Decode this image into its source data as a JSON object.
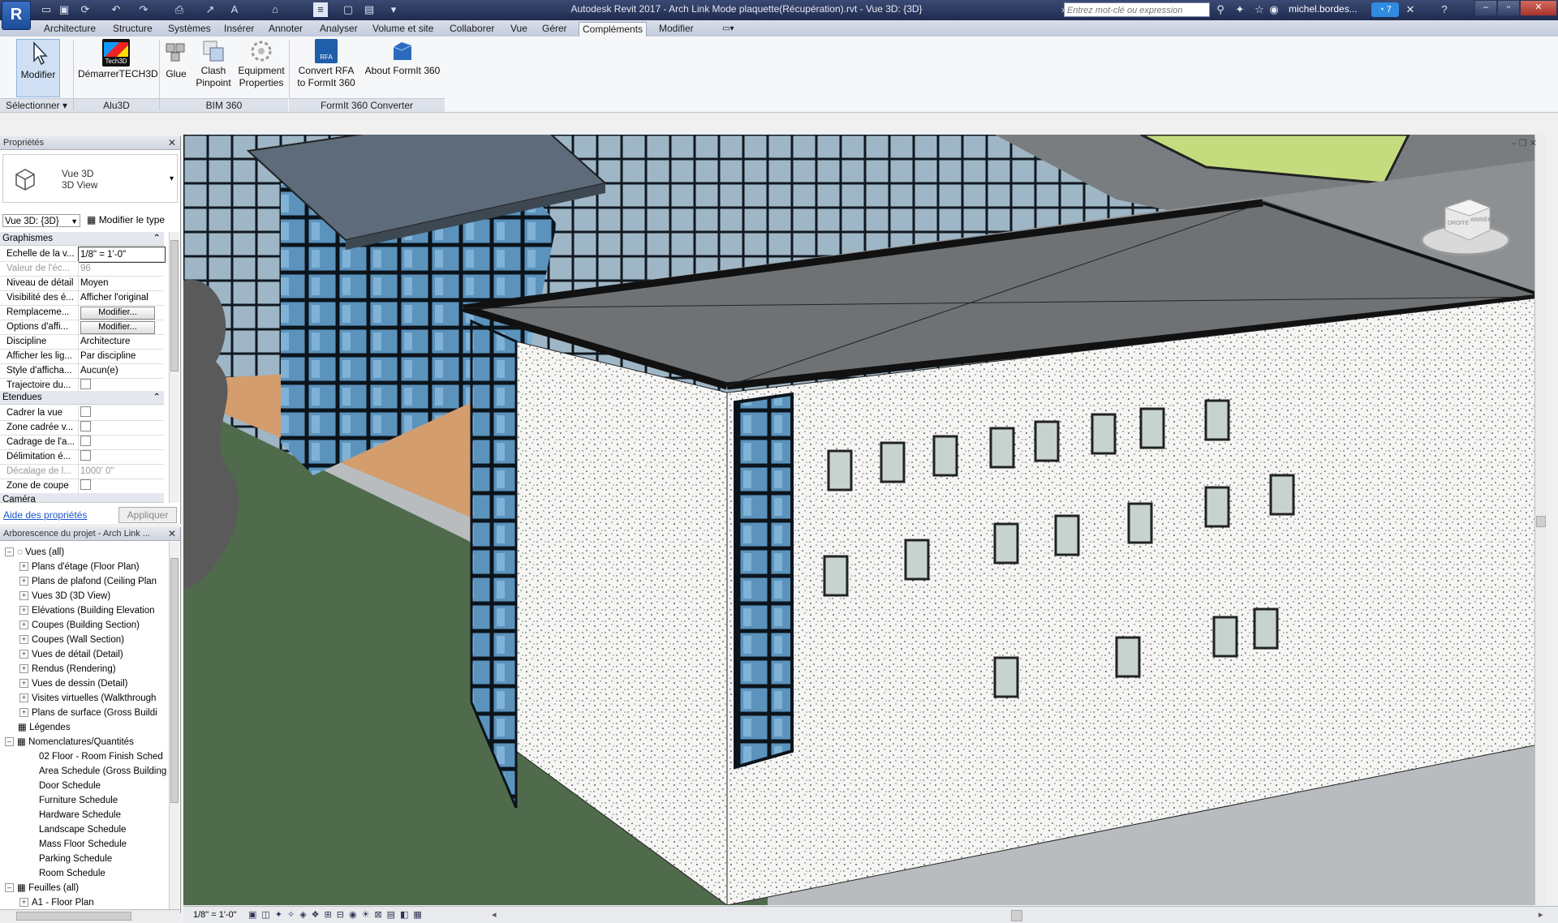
{
  "app": {
    "logo_letter": "R",
    "title": "Autodesk Revit 2017 -     Arch Link Mode plaquette(Récupération).rvt - Vue 3D: {3D}",
    "search_placeholder": "Entrez mot-clé ou expression",
    "user": "michel.bordes...",
    "notif_count": "7"
  },
  "menu_tabs": [
    "Architecture",
    "Structure",
    "Systèmes",
    "Insérer",
    "Annoter",
    "Analyser",
    "Volume et site",
    "Collaborer",
    "Vue",
    "Gérer",
    "Compléments",
    "Modifier"
  ],
  "active_tab": "Compléments",
  "ribbon": {
    "modifier": "Modifier",
    "demarrer": "DémarrerTECH3D",
    "glue": "Glue",
    "clash_1": "Clash",
    "clash_2": "Pinpoint",
    "equip_1": "Equipment",
    "equip_2": "Properties",
    "convert_1": "Convert RFA",
    "convert_2": "to FormIt 360",
    "about": "About FormIt 360",
    "icon_tech3d": "Tech3D",
    "icon_rfa": "RFA",
    "panels": {
      "selectionner": "Sélectionner",
      "alu3d": "Alu3D",
      "bim360": "BIM 360",
      "formit": "FormIt 360 Converter"
    }
  },
  "properties": {
    "title": "Propriétés",
    "type_name_1": "Vue 3D",
    "type_name_2": "3D View",
    "view_selector": "Vue 3D: {3D}",
    "edit_type": "Modifier le type",
    "group_graphics": "Graphismes",
    "group_extents": "Etendues",
    "group_camera": "Caméra",
    "rows": [
      {
        "k": "Echelle de la v...",
        "v": "1/8\" = 1'-0\""
      },
      {
        "k": "Valeur de l'éc...",
        "v": "96"
      },
      {
        "k": "Niveau de détail",
        "v": "Moyen"
      },
      {
        "k": "Visibilité des é...",
        "v": "Afficher l'original"
      },
      {
        "k": "Remplaceme...",
        "v": "Modifier..."
      },
      {
        "k": "Options d'affi...",
        "v": "Modifier..."
      },
      {
        "k": "Discipline",
        "v": "Architecture"
      },
      {
        "k": "Afficher les lig...",
        "v": "Par discipline"
      },
      {
        "k": "Style d'afficha...",
        "v": "Aucun(e)"
      },
      {
        "k": "Trajectoire du...",
        "v": ""
      }
    ],
    "extent_rows": [
      {
        "k": "Cadrer la vue",
        "v": ""
      },
      {
        "k": "Zone cadrée v...",
        "v": ""
      },
      {
        "k": "Cadrage de l'a...",
        "v": ""
      },
      {
        "k": "Délimitation é...",
        "v": ""
      },
      {
        "k": "Décalage de l...",
        "v": "1000'  0\""
      },
      {
        "k": "Zone de coupe",
        "v": ""
      }
    ],
    "help_link": "Aide des propriétés",
    "apply": "Appliquer"
  },
  "browser": {
    "title": "Arborescence du projet - Arch Link ...",
    "items": [
      "Vues (all)",
      "Plans d'étage (Floor Plan)",
      "Plans de plafond (Ceiling Plan",
      "Vues 3D (3D View)",
      "Elévations (Building Elevation",
      "Coupes (Building Section)",
      "Coupes (Wall Section)",
      "Vues de détail (Detail)",
      "Rendus (Rendering)",
      "Vues de dessin (Detail)",
      "Visites virtuelles (Walkthrough",
      "Plans de surface (Gross Buildi",
      "Légendes",
      "Nomenclatures/Quantités",
      "02 Floor - Room Finish Sched",
      "Area Schedule (Gross Building",
      "Door Schedule",
      "Furniture Schedule",
      "Hardware Schedule",
      "Landscape Schedule",
      "Mass Floor Schedule",
      "Parking Schedule",
      "Room Schedule",
      "Feuilles (all)",
      "A1 - Floor Plan"
    ]
  },
  "viewcube": {
    "face_1": "DROITE",
    "face_2": "ARRIÈRE"
  },
  "status": {
    "scale": "1/8\" = 1'-0\""
  },
  "colors": {
    "accent": "#1d4c98",
    "roof": "#6e7173",
    "wall": "#f4f4f2",
    "glass": "#3d83b8",
    "ground": "#4d6a4a",
    "deck": "#cf9a6b"
  }
}
